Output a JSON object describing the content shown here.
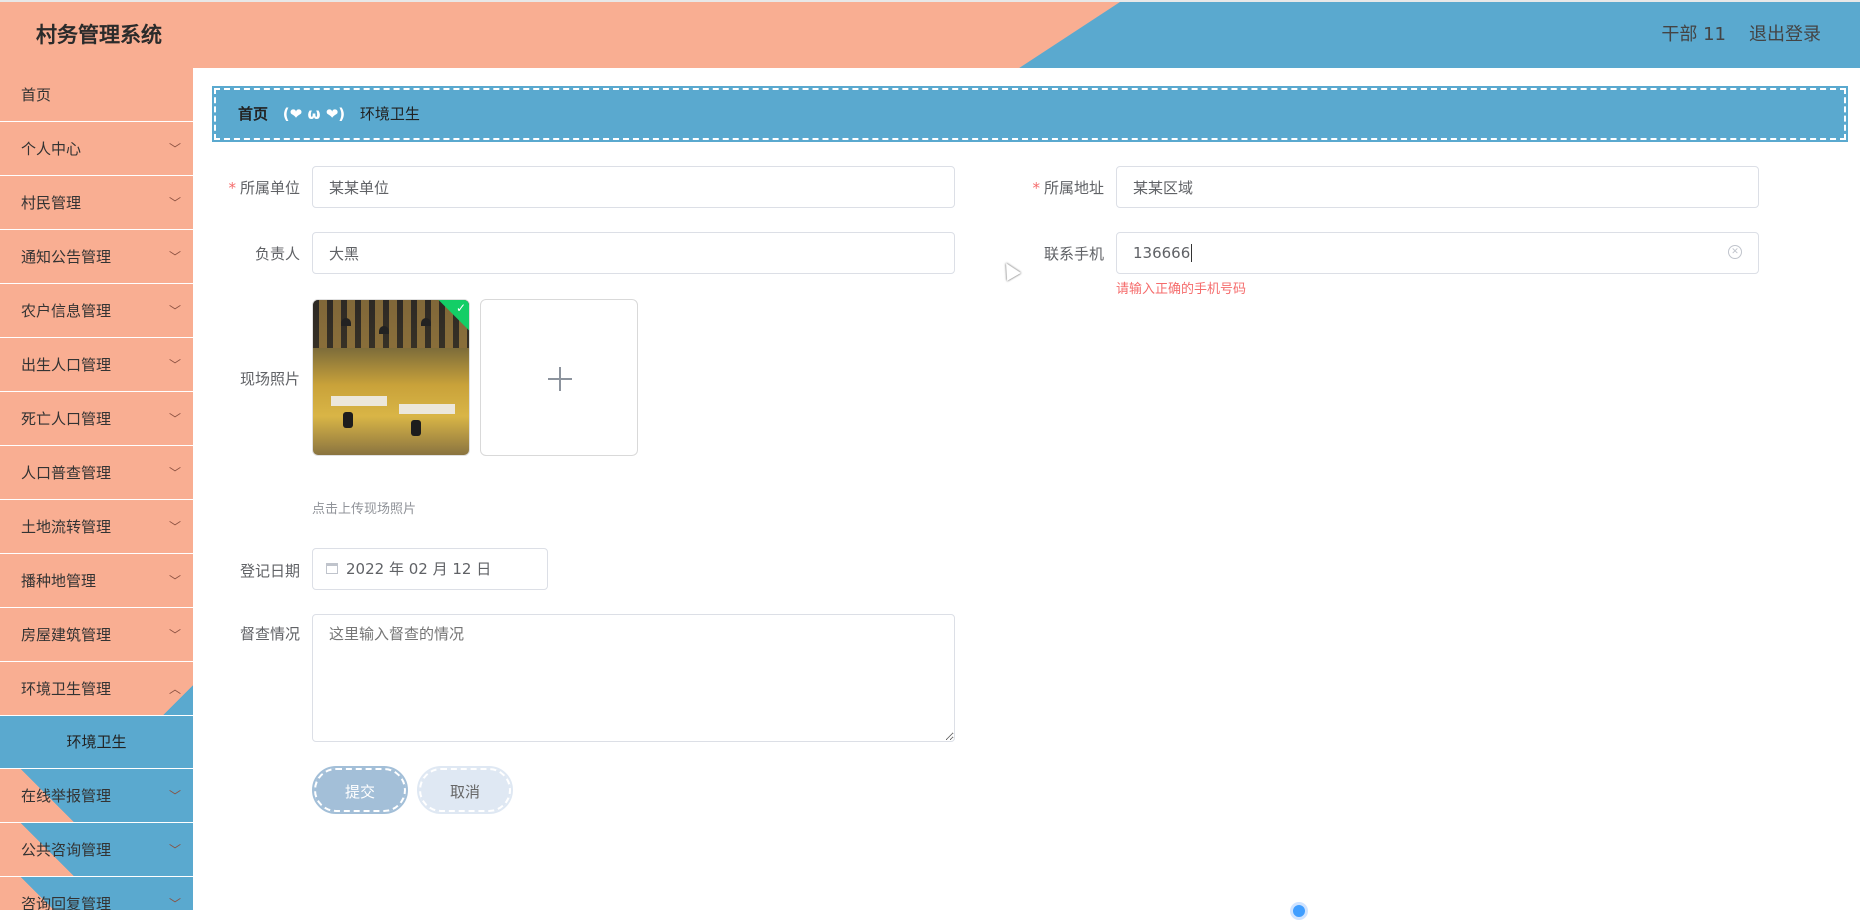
{
  "header": {
    "title": "村务管理系统",
    "user": "干部 11",
    "logout": "退出登录"
  },
  "sidebar": {
    "items": [
      {
        "label": "首页",
        "has_arrow": false
      },
      {
        "label": "个人中心",
        "has_arrow": true
      },
      {
        "label": "村民管理",
        "has_arrow": true
      },
      {
        "label": "通知公告管理",
        "has_arrow": true
      },
      {
        "label": "农户信息管理",
        "has_arrow": true
      },
      {
        "label": "出生人口管理",
        "has_arrow": true
      },
      {
        "label": "死亡人口管理",
        "has_arrow": true
      },
      {
        "label": "人口普查管理",
        "has_arrow": true
      },
      {
        "label": "土地流转管理",
        "has_arrow": true
      },
      {
        "label": "播种地管理",
        "has_arrow": true
      },
      {
        "label": "房屋建筑管理",
        "has_arrow": true
      },
      {
        "label": "环境卫生管理",
        "has_arrow": true,
        "expanded": true
      },
      {
        "label": "在线举报管理",
        "has_arrow": true
      },
      {
        "label": "公共咨询管理",
        "has_arrow": true
      },
      {
        "label": "咨询回复管理",
        "has_arrow": true
      }
    ],
    "sub_item": "环境卫生",
    "chevron": "chevron-down-icon"
  },
  "breadcrumb": {
    "home": "首页",
    "separator": "(❤ ω ❤)",
    "current": "环境卫生"
  },
  "form": {
    "unit": {
      "label": "所属单位",
      "value": "某某单位",
      "required": true
    },
    "address": {
      "label": "所属地址",
      "value": "某某区域",
      "required": true
    },
    "manager": {
      "label": "负责人",
      "value": "大黑"
    },
    "phone": {
      "label": "联系手机",
      "value": "136666",
      "error": "请输入正确的手机号码"
    },
    "photo": {
      "label": "现场照片",
      "tip": "点击上传现场照片"
    },
    "date": {
      "label": "登记日期",
      "value": "2022 年 02 月 12 日"
    },
    "inspection": {
      "label": "督查情况",
      "placeholder": "这里输入督查的情况"
    },
    "submit": "提交",
    "cancel": "取消"
  },
  "colors": {
    "peach": "#f9ae92",
    "blue": "#5aa9cf",
    "error": "#f56c6c",
    "success": "#13ce66"
  }
}
